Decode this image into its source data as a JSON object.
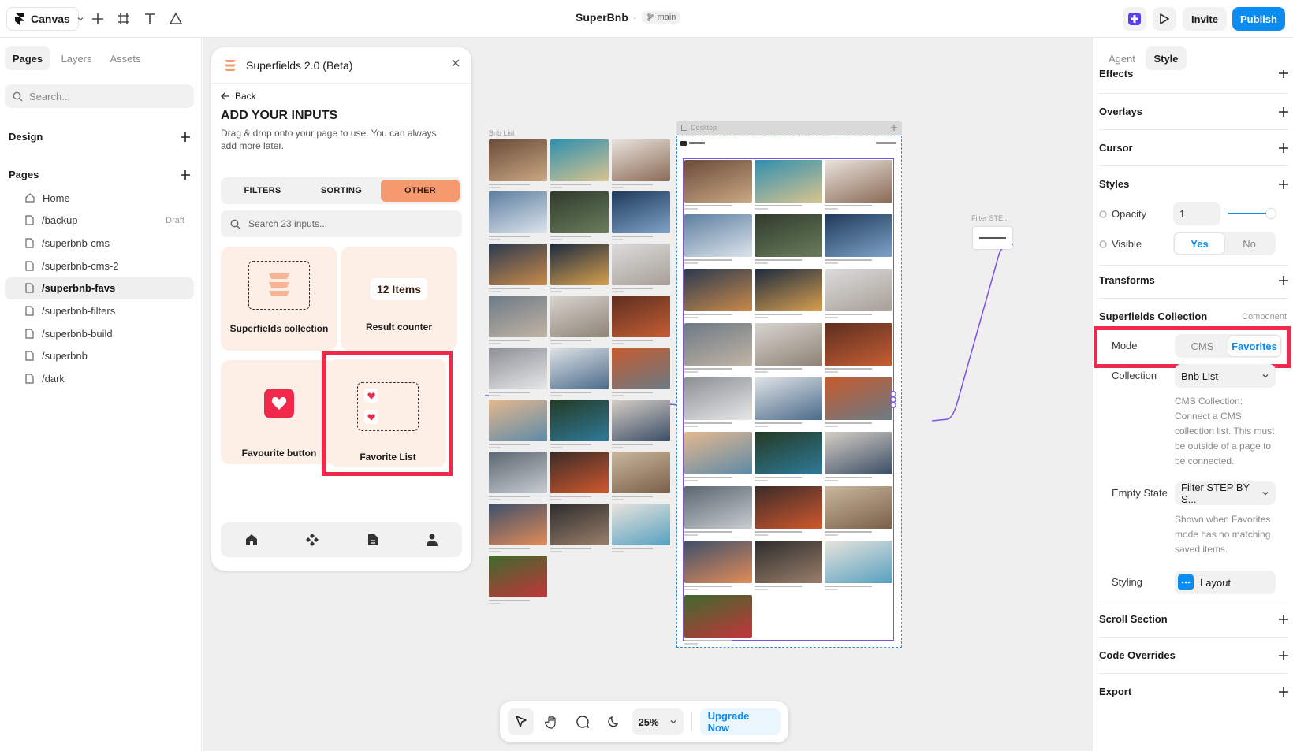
{
  "topbar": {
    "canvas_label": "Canvas",
    "project_name": "SuperBnb",
    "separator": "·",
    "branch": "main",
    "invite_label": "Invite",
    "publish_label": "Publish"
  },
  "sidebar": {
    "tabs": [
      "Pages",
      "Layers",
      "Assets"
    ],
    "search_placeholder": "Search...",
    "design_label": "Design",
    "pages_label": "Pages",
    "pages": [
      {
        "label": "Home",
        "icon": "home-icon",
        "tag": ""
      },
      {
        "label": "/backup",
        "icon": "page-icon",
        "tag": "Draft"
      },
      {
        "label": "/superbnb-cms",
        "icon": "page-icon",
        "tag": ""
      },
      {
        "label": "/superbnb-cms-2",
        "icon": "page-icon",
        "tag": ""
      },
      {
        "label": "/superbnb-favs",
        "icon": "page-icon",
        "tag": "",
        "active": true
      },
      {
        "label": "/superbnb-filters",
        "icon": "page-icon",
        "tag": ""
      },
      {
        "label": "/superbnb-build",
        "icon": "page-icon",
        "tag": ""
      },
      {
        "label": "/superbnb",
        "icon": "page-icon",
        "tag": ""
      },
      {
        "label": "/dark",
        "icon": "page-icon",
        "tag": ""
      }
    ]
  },
  "plugin": {
    "title": "Superfields 2.0 (Beta)",
    "back_label": "Back",
    "heading": "ADD YOUR INPUTS",
    "description": "Drag & drop onto your page to use. You can always add more later.",
    "tabs": [
      "FILTERS",
      "SORTING",
      "OTHER"
    ],
    "active_tab": "OTHER",
    "search_placeholder": "Search 23 inputs...",
    "cards": {
      "collection": "Superfields collection",
      "counter_badge": "12 Items",
      "counter": "Result counter",
      "fav_button": "Favourite button",
      "fav_list": "Favorite List"
    }
  },
  "canvas": {
    "bnb_list_label": "Bnb List",
    "desktop_label": "Desktop",
    "filter_label": "Filter STE..."
  },
  "zoom": {
    "level": "25%",
    "upgrade_label": "Upgrade Now"
  },
  "rightpanel": {
    "tabs": [
      "Agent",
      "Style"
    ],
    "effects": "Effects",
    "overlays": "Overlays",
    "cursor": "Cursor",
    "styles": "Styles",
    "opacity_label": "Opacity",
    "opacity_value": "1",
    "opacity_level": 1.0,
    "visible_label": "Visible",
    "visible_yes": "Yes",
    "visible_no": "No",
    "transforms": "Transforms",
    "sf_collection": "Superfields Collection",
    "sf_tag": "Component",
    "mode_label": "Mode",
    "mode_cms": "CMS",
    "mode_favorites": "Favorites",
    "collection_label": "Collection",
    "collection_value": "Bnb List",
    "cms_help_title": "CMS Collection:",
    "cms_help": "Connect a CMS collection list. This must be outside of a page to be connected.",
    "empty_state_label": "Empty State",
    "empty_state_value": "Filter STEP BY S...",
    "empty_help": "Shown when Favorites mode has no matching saved items.",
    "styling_label": "Styling",
    "styling_value": "Layout",
    "scroll_section": "Scroll Section",
    "code_overrides": "Code Overrides",
    "export": "Export"
  },
  "colors": {
    "accent": "#0a8cf0",
    "highlight": "#f0284a",
    "plugin_accent": "#f59a6e",
    "card_bg": "#fdeee6",
    "connector": "#7b52e8"
  }
}
